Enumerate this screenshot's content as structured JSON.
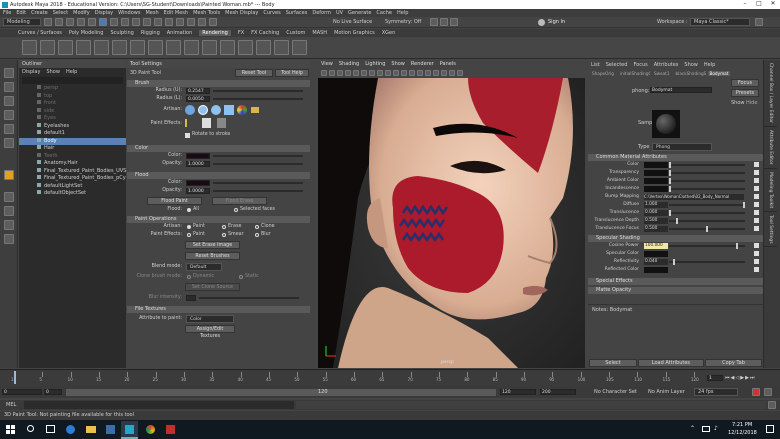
{
  "window": {
    "title": "Autodesk Maya 2018 - Educational Version: C:\\Users\\SG-Student\\Downloads\\Painted Woman.mb* --- Body"
  },
  "menubar": [
    "File",
    "Edit",
    "Create",
    "Select",
    "Modify",
    "Display",
    "Windows",
    "Mesh",
    "Edit Mesh",
    "Mesh Tools",
    "Mesh Display",
    "Curves",
    "Surfaces",
    "Deform",
    "UV",
    "Generate",
    "Cache",
    "Help"
  ],
  "statusline": {
    "mode": "Modeling",
    "live_surface": "No Live Surface",
    "symmetry": "Symmetry: Off",
    "sign_in": "Sign In",
    "workspace_label": "Workspace :",
    "workspace": "Maya Classic*"
  },
  "shelf": {
    "tabs": [
      "Curves / Surfaces",
      "Poly Modeling",
      "Sculpting",
      "Rigging",
      "Animation",
      "Rendering",
      "FX",
      "FX Caching",
      "Custom",
      "MASH",
      "Motion Graphics",
      "XGen"
    ],
    "active": "Rendering"
  },
  "outliner": {
    "title": "Outliner",
    "menu": [
      "Display",
      "Show",
      "Help"
    ],
    "items": [
      {
        "label": "persp",
        "dim": true
      },
      {
        "label": "top",
        "dim": true
      },
      {
        "label": "front",
        "dim": true
      },
      {
        "label": "side",
        "dim": true
      },
      {
        "label": "Eyes",
        "dim": true
      },
      {
        "label": "Eyelashes",
        "dim": false
      },
      {
        "label": "default1",
        "dim": false
      },
      {
        "label": "Body",
        "dim": false,
        "selected": true
      },
      {
        "label": "Hair",
        "dim": false
      },
      {
        "label": "Teeth",
        "dim": true
      },
      {
        "label": "Anatomy.Hair",
        "dim": false
      },
      {
        "label": "Final_Textured_Paint_Bodies_UVSet1",
        "dim": false
      },
      {
        "label": "Final_Textured_Paint_Bodies_pCylinder",
        "dim": false
      },
      {
        "label": "defaultLightSet",
        "dim": false
      },
      {
        "label": "defaultObjectSet",
        "dim": false
      }
    ]
  },
  "tool_settings": {
    "title": "Tool Settings",
    "tool_name": "3D Paint Tool",
    "reset_button": "Reset Tool",
    "help_button": "Tool Help",
    "brush": {
      "header": "Brush",
      "radius_u_label": "Radius (U):",
      "radius_u": "0.2547",
      "radius_l_label": "Radius (L):",
      "radius_l": "0.0050",
      "artisan_label": "Artisan:",
      "paint_effects_label": "Paint Effects:",
      "rotate_label": "Rotate to stroke"
    },
    "color": {
      "header": "Color",
      "color_label": "Color:",
      "opacity_label": "Opacity:",
      "opacity": "1.0000"
    },
    "flood": {
      "header": "Flood",
      "color_label": "Color:",
      "opacity_label": "Opacity:",
      "opacity": "1.0000",
      "flood_paint": "Flood Paint",
      "flood_erase": "Flood Erase",
      "flood_label": "Flood:",
      "all": "All",
      "selected_faces": "Selected faces"
    },
    "paint_ops": {
      "header": "Paint Operations",
      "artisan_label": "Artisan:",
      "paint": "Paint",
      "erase": "Erase",
      "clone": "Clone",
      "pe_label": "Paint Effects:",
      "pe_paint": "Paint",
      "smear": "Smear",
      "blur": "Blur",
      "set_erase": "Set Erase Image",
      "reset_brushes": "Reset Brushes",
      "blend_label": "Blend mode:",
      "blend": "Default",
      "clone_label": "Clone brush mode:",
      "dynamic": "Dynamic",
      "static": "Static",
      "set_clone": "Set Clone Source",
      "blur_label": "Blur intensity:"
    },
    "file_textures": {
      "header": "File Textures",
      "attr_label": "Attribute to paint:",
      "attr": "Color",
      "assign_button": "Assign/Edit Textures"
    }
  },
  "viewport": {
    "menu": [
      "View",
      "Shading",
      "Lighting",
      "Show",
      "Renderer",
      "Panels"
    ],
    "camera": "persp"
  },
  "attribute_editor": {
    "menu": [
      "List",
      "Selected",
      "Focus",
      "Attributes",
      "Show",
      "Help"
    ],
    "tabs": [
      "ShapeOrig",
      "initialShadingGroup",
      "Sweat1",
      "blackShadingSwitch1",
      "Bodymat"
    ],
    "active_tab": "Bodymat",
    "type_label": "phong:",
    "name": "Bodymat",
    "focus": "Focus",
    "presets": "Presets",
    "show": "Show",
    "hide": "Hide",
    "sample_label": "Sample",
    "type_field_label": "Type",
    "type_value": "Phong",
    "common_header": "Common Material Attributes",
    "common": [
      {
        "label": "Color",
        "swatch": "#111111",
        "bar": 0
      },
      {
        "label": "Transparency",
        "swatch": "#111111",
        "bar": 0
      },
      {
        "label": "Ambient Color",
        "swatch": "#111111",
        "bar": 0
      },
      {
        "label": "Incandescence",
        "swatch": "#111111",
        "bar": 0
      },
      {
        "label": "Bump Mapping",
        "text": "C:\\Vertex\\WomanClothed\\02_Body_Normal"
      },
      {
        "label": "Diffuse",
        "value": "1.000",
        "bar": 1
      },
      {
        "label": "Translucence",
        "value": "0.000",
        "bar": 0
      },
      {
        "label": "Translucence Depth",
        "value": "0.500",
        "bar": 0.1
      },
      {
        "label": "Translucence Focus",
        "value": "0.500",
        "bar": 0.5
      }
    ],
    "specular_header": "Specular Shading",
    "specular": [
      {
        "label": "Cosine Power",
        "value": "100.000",
        "bar": 0.9,
        "highlight": true
      },
      {
        "label": "Specular Color",
        "swatch": "#111111"
      },
      {
        "label": "Reflectivity",
        "value": "0.040",
        "bar": 0.05
      },
      {
        "label": "Reflected Color",
        "swatch": "#111111"
      }
    ],
    "special_effects": "Special Effects",
    "matte_opacity": "Matte Opacity",
    "notes_label": "Notes: Bodymat",
    "select": "Select",
    "load_attributes": "Load Attributes",
    "copy_tab": "Copy Tab"
  },
  "side_tabs": [
    "Channel Box / Layer Editor",
    "Attribute Editor",
    "Modeling Toolkit",
    "Tool Settings"
  ],
  "timeslider": {
    "ticks": [
      "1",
      "5",
      "10",
      "15",
      "20",
      "25",
      "30",
      "35",
      "40",
      "45",
      "50",
      "55",
      "60",
      "65",
      "70",
      "75",
      "80",
      "85",
      "90",
      "95",
      "100",
      "105",
      "110",
      "115",
      "120"
    ],
    "current": "1"
  },
  "range": {
    "start": "0",
    "start_inner": "0",
    "end_inner": "120",
    "end": "120",
    "end2": "200",
    "character": "No Character Set",
    "anim_layer": "No Anim Layer",
    "fps": "24 fps"
  },
  "cmd": {
    "label": "MEL"
  },
  "help_line": "3D Paint Tool: Not painting file available for this tool",
  "taskbar": {
    "time": "7:21 PM",
    "date": "12/12/2018"
  }
}
